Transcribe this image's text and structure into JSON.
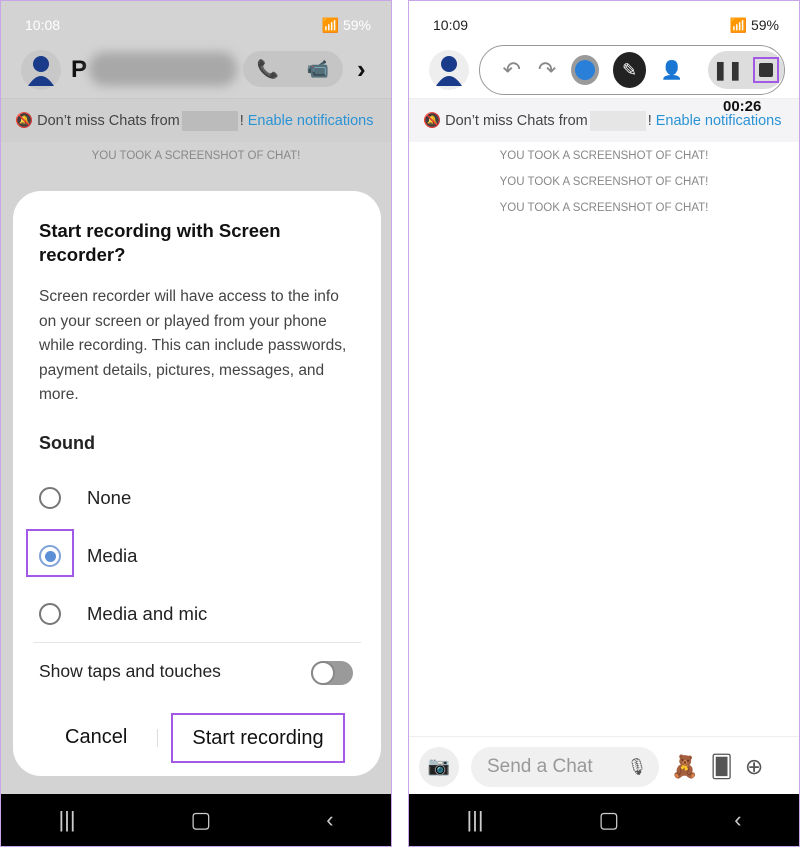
{
  "left": {
    "status": {
      "time": "10:08",
      "battery": "59%"
    },
    "header": {
      "name_initial": "P"
    },
    "notification": {
      "text": "Don’t miss Chats from",
      "suffix": "!",
      "link": "Enable notifications"
    },
    "screenshot_notice": "YOU TOOK A SCREENSHOT OF CHAT!",
    "dialog": {
      "title": "Start recording with Screen recorder?",
      "body": "Screen recorder will have access to the info on your screen or played from your phone while recording. This can include passwords, payment details, pictures, messages, and more.",
      "sound_label": "Sound",
      "options": [
        {
          "label": "None",
          "selected": false
        },
        {
          "label": "Media",
          "selected": true
        },
        {
          "label": "Media and mic",
          "selected": false
        }
      ],
      "show_taps_label": "Show taps and touches",
      "show_taps_on": false,
      "cancel": "Cancel",
      "start": "Start recording"
    }
  },
  "right": {
    "status": {
      "time": "10:09",
      "battery": "59%"
    },
    "timer": "00:26",
    "notification": {
      "text": "Don’t miss Chats from",
      "suffix": "!",
      "link": "Enable notifications"
    },
    "screenshot_notices": [
      "YOU TOOK A SCREENSHOT OF CHAT!",
      "YOU TOOK A SCREENSHOT OF CHAT!",
      "YOU TOOK A SCREENSHOT OF CHAT!"
    ],
    "chat_placeholder": "Send a Chat"
  },
  "colors": {
    "highlight": "#a259e6",
    "link": "#2a93d5",
    "pen_blue": "#2a7fd8"
  }
}
